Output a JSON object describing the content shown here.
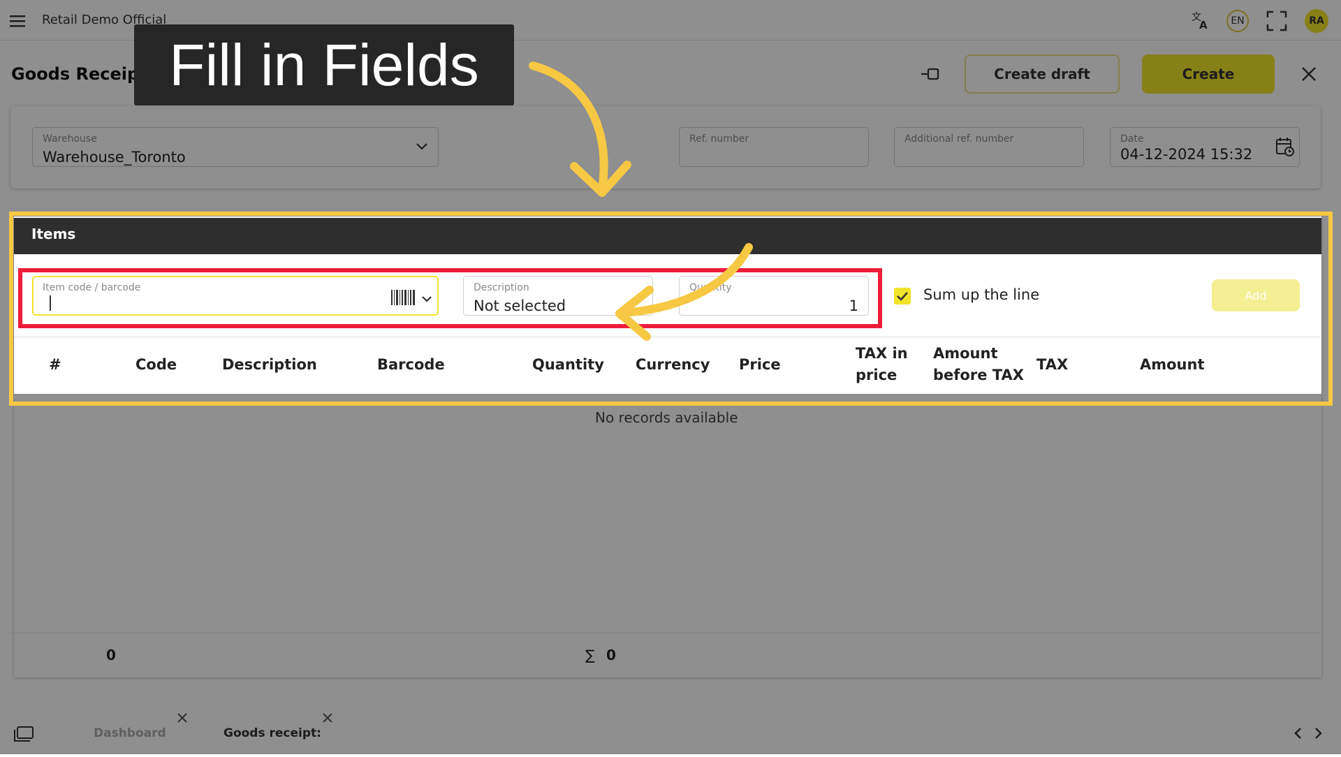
{
  "app": {
    "title": "Retail Demo Official",
    "language": "EN",
    "user_initials": "RA"
  },
  "page": {
    "title": "Goods Receipt: New",
    "create_draft_label": "Create draft",
    "create_label": "Create"
  },
  "form": {
    "warehouse": {
      "label": "Warehouse",
      "value": "Warehouse_Toronto"
    },
    "ref_number": {
      "label": "Ref. number",
      "value": ""
    },
    "additional_ref_number": {
      "label": "Additional ref. number",
      "value": ""
    },
    "date": {
      "label": "Date",
      "value": "04-12-2024 15:32"
    }
  },
  "items": {
    "title": "Items",
    "item_code": {
      "label": "Item code / barcode",
      "value": ""
    },
    "description": {
      "label": "Description",
      "value": "Not selected"
    },
    "quantity": {
      "label": "Quantity",
      "value": "1"
    },
    "sum_up_label": "Sum up the line",
    "sum_up_checked": true,
    "add_label": "Add",
    "columns": {
      "num": "#",
      "code": "Code",
      "description": "Description",
      "barcode": "Barcode",
      "quantity": "Quantity",
      "currency": "Currency",
      "price": "Price",
      "tax_in_price_1": "TAX in",
      "tax_in_price_2": "price",
      "amount_before_tax_1": "Amount",
      "amount_before_tax_2": "before TAX",
      "tax": "TAX",
      "amount": "Amount"
    },
    "empty_text": "No records available",
    "footer_count": "0",
    "footer_sum_symbol": "∑",
    "footer_sum": "0"
  },
  "tabs": [
    {
      "label": "Dashboard"
    },
    {
      "label": "Goods receipt:"
    }
  ],
  "callout": {
    "text": "Fill in Fields"
  },
  "colors": {
    "accent": "#f1e42a",
    "highlight_yellow": "#f7c843",
    "highlight_red": "#ee1c3a",
    "dark": "#2e2e2e"
  },
  "icons": [
    "menu-icon",
    "translate-icon",
    "fullscreen-icon",
    "pin-icon",
    "close-icon",
    "chevron-down-icon",
    "calendar-icon",
    "barcode-icon",
    "check-icon",
    "window-icon",
    "chevron-left-icon",
    "chevron-right-icon"
  ]
}
